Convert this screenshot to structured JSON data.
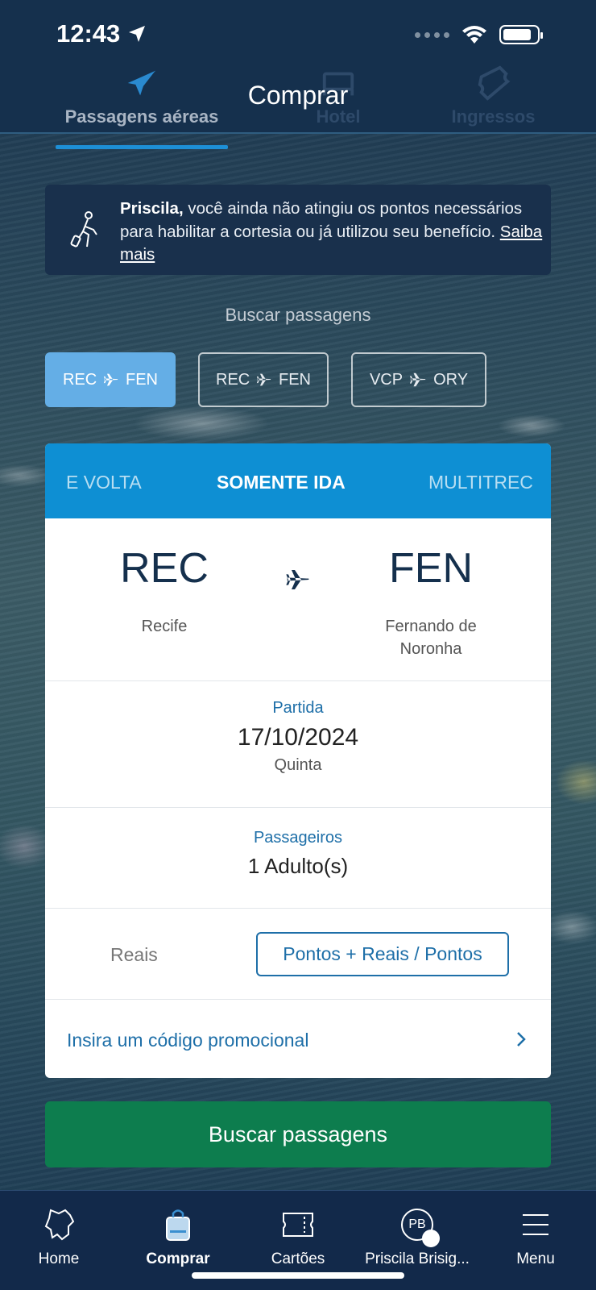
{
  "status": {
    "time": "12:43"
  },
  "header": {
    "title": "Comprar",
    "tabs": [
      {
        "label": "Passagens aéreas",
        "icon": "airplane-icon",
        "active": true
      },
      {
        "label": "Hotel",
        "icon": "bed-icon",
        "active": false
      },
      {
        "label": "Ingressos",
        "icon": "ticket-icon",
        "active": false
      }
    ]
  },
  "notice": {
    "name": "Priscila,",
    "text": " você ainda não atingiu os pontos necessários para habilitar a cortesia ou já utilizou seu benefício. ",
    "link": "Saiba mais"
  },
  "search": {
    "label": "Buscar passagens",
    "recent": [
      {
        "from": "REC",
        "to": "FEN",
        "selected": true
      },
      {
        "from": "REC",
        "to": "FEN",
        "selected": false
      },
      {
        "from": "VCP",
        "to": "ORY",
        "selected": false
      }
    ]
  },
  "trip_type": {
    "options": [
      "E VOLTA",
      "SOMENTE IDA",
      "MULTITREC"
    ],
    "selected": "SOMENTE IDA"
  },
  "route": {
    "origin_code": "REC",
    "origin_city": "Recife",
    "dest_code": "FEN",
    "dest_city_1": "Fernando de",
    "dest_city_2": "Noronha"
  },
  "departure": {
    "label": "Partida",
    "date": "17/10/2024",
    "weekday": "Quinta"
  },
  "passengers": {
    "label": "Passageiros",
    "value": "1 Adulto(s)"
  },
  "currency": {
    "reais": "Reais",
    "points": "Pontos + Reais / Pontos"
  },
  "promo": {
    "label": "Insira um código promocional"
  },
  "action": {
    "search_button": "Buscar passagens"
  },
  "bottom_nav": [
    {
      "label": "Home",
      "icon": "map-icon"
    },
    {
      "label": "Comprar",
      "icon": "shopping-bag-icon",
      "active": true
    },
    {
      "label": "Cartões",
      "icon": "card-icon"
    },
    {
      "label": "Priscila Brisig...",
      "icon": "avatar",
      "initials": "PB"
    },
    {
      "label": "Menu",
      "icon": "hamburger-icon"
    }
  ],
  "colors": {
    "accent": "#0e8fd3",
    "primary_button": "#0d7d4e",
    "dark": "#15304d"
  }
}
